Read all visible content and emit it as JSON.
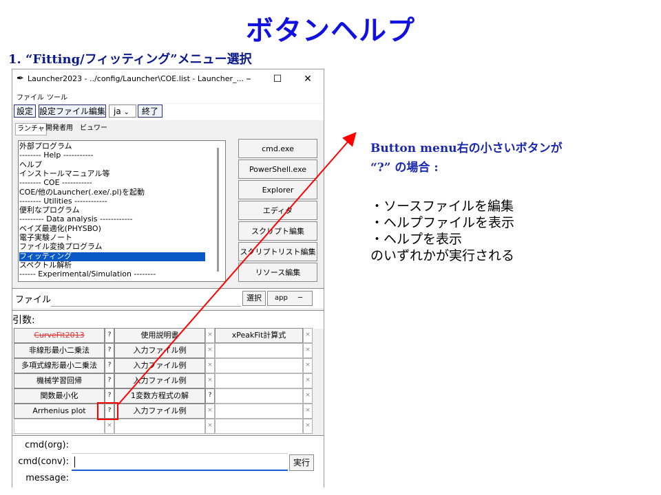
{
  "slide": {
    "title": "ボタンヘルプ",
    "section_heading": "1. “Fitting/フィッティング”メニュー選択"
  },
  "window": {
    "title": "Launcher2023 - ../config/Launcher\\COE.list - Launcher_...",
    "minimize": "–",
    "maximize": "☐",
    "close": "✕",
    "menu": [
      "ファイル",
      "ツール"
    ],
    "toolbar": {
      "settings": "設定",
      "edit_config": "設定ファイル編集",
      "lang_value": "ja",
      "lang_caret": "⌄",
      "exit": "終了"
    },
    "tabs": [
      "ランチャ",
      "開発者用",
      "ビュワー"
    ],
    "list_items": [
      "外部プログラム",
      "-------- Help -----------",
      "ヘルプ",
      "インストールマニュアル等",
      "-------- COE -----------",
      "COE/他のLauncher(.exe/.pl)を起動",
      "-------- Utilities ------------",
      "便利なプログラム",
      "--------- Data analysis ------------",
      "ベイズ最適化(PHYSBO)",
      "電子実験ノート",
      "ファイル変換プログラム",
      "フィッティング",
      "スペクトル解析",
      "------ Experimental/Simulation --------"
    ],
    "selected_index": 12,
    "right_buttons": [
      "cmd.exe",
      "PowerShell.exe",
      "Explorer",
      "エディタ",
      "スクリプト編集",
      "スクリプトリスト編集",
      "リソース編集"
    ],
    "file_label": "ファイル:",
    "file_value": "",
    "select_button": "選択",
    "app_value": "app",
    "app_caret": "─",
    "args_label": "引数:",
    "args_value": "",
    "grid": {
      "col1": [
        "CurveFit2013",
        "非線形最小二乗法",
        "多項式線形最小二乗法",
        "機械学習回帰",
        "関数最小化",
        "Arrhenius plot"
      ],
      "col2": [
        "使用説明書",
        "入力ファイル例",
        "入力ファイル例",
        "入力ファイル例",
        "1変数方程式の解",
        "入力ファイル例"
      ],
      "col3": [
        "xPeakFit計算式"
      ],
      "q_mark": "?",
      "x_mark": "×",
      "disabled_color": "#e03030"
    },
    "cmd_org_label": "cmd(org):",
    "cmd_org_value": "",
    "cmd_conv_label": "cmd(conv):",
    "cmd_conv_value": "",
    "run_button": "実行",
    "message_label": "message:",
    "message_value": ""
  },
  "annotation": {
    "heading_line1": "Button menu右の小さいボタンが",
    "heading_line2": "“?” の場合 :",
    "bullets": [
      "・ソースファイルを編集",
      "・ヘルプファイルを表示",
      "・ヘルプを表示"
    ],
    "conclusion": "のいずれかが実行される",
    "arrow_color": "#ff0000",
    "title_color": "#1010e0"
  }
}
